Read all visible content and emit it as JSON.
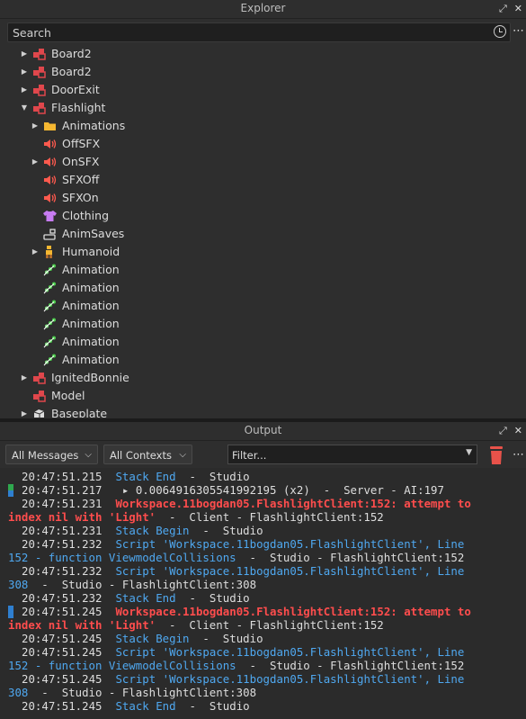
{
  "explorer": {
    "title": "Explorer",
    "search_placeholder": "Search",
    "items": [
      {
        "label": "Board2",
        "icon": "model-icon",
        "expand": "collapsed",
        "indent": 0
      },
      {
        "label": "Board2",
        "icon": "model-icon",
        "expand": "collapsed",
        "indent": 0
      },
      {
        "label": "DoorExit",
        "icon": "model-icon",
        "expand": "collapsed",
        "indent": 0
      },
      {
        "label": "Flashlight",
        "icon": "model-icon",
        "expand": "expanded",
        "indent": 0
      },
      {
        "label": "Animations",
        "icon": "folder-icon",
        "expand": "collapsed",
        "indent": 1
      },
      {
        "label": "OffSFX",
        "icon": "sound-icon",
        "expand": "none",
        "indent": 1
      },
      {
        "label": "OnSFX",
        "icon": "sound-icon",
        "expand": "collapsed",
        "indent": 1
      },
      {
        "label": "SFXOff",
        "icon": "sound-icon",
        "expand": "none",
        "indent": 1
      },
      {
        "label": "SFXOn",
        "icon": "sound-icon",
        "expand": "none",
        "indent": 1
      },
      {
        "label": "Clothing",
        "icon": "shirt-icon",
        "expand": "none",
        "indent": 1
      },
      {
        "label": "AnimSaves",
        "icon": "object-value-icon",
        "expand": "none",
        "indent": 1
      },
      {
        "label": "Humanoid",
        "icon": "humanoid-icon",
        "expand": "collapsed",
        "indent": 1
      },
      {
        "label": "Animation",
        "icon": "animation-icon",
        "expand": "none",
        "indent": 1
      },
      {
        "label": "Animation",
        "icon": "animation-icon",
        "expand": "none",
        "indent": 1
      },
      {
        "label": "Animation",
        "icon": "animation-icon",
        "expand": "none",
        "indent": 1
      },
      {
        "label": "Animation",
        "icon": "animation-icon",
        "expand": "none",
        "indent": 1
      },
      {
        "label": "Animation",
        "icon": "animation-icon",
        "expand": "none",
        "indent": 1
      },
      {
        "label": "Animation",
        "icon": "animation-icon",
        "expand": "none",
        "indent": 1
      },
      {
        "label": "IgnitedBonnie",
        "icon": "model-icon",
        "expand": "collapsed",
        "indent": 0
      },
      {
        "label": "Model",
        "icon": "model-icon",
        "expand": "none",
        "indent": 0
      },
      {
        "label": "Baseplate",
        "icon": "part-icon",
        "expand": "collapsed",
        "indent": 0
      }
    ]
  },
  "output": {
    "title": "Output",
    "messages_filter": "All Messages",
    "contexts_filter": "All Contexts",
    "filter_placeholder": "Filter...",
    "lines": [
      {
        "segments": [
          {
            "t": "20:47:51.215  ",
            "c": "out"
          },
          {
            "t": "Stack End",
            "c": "info"
          },
          {
            "t": "  -  Studio",
            "c": "out"
          }
        ]
      },
      {
        "segments": [
          {
            "t": "20:47:51.217   ",
            "c": "out"
          },
          {
            "t": "▸ 0.00649163055419921​95 (x2)",
            "c": "out"
          },
          {
            "t": "  -  Server - AI:197",
            "c": "out"
          }
        ],
        "marker": "server"
      },
      {
        "segments": [
          {
            "t": "20:47:51.231  ",
            "c": "out"
          },
          {
            "t": "Workspace.11bogdan05.FlashlightClient:152: attempt to",
            "c": "err"
          }
        ]
      },
      {
        "segments": [
          {
            "t": "index nil with 'Light'",
            "c": "err"
          },
          {
            "t": "  -  Client - FlashlightClient:152",
            "c": "out"
          }
        ],
        "wrap": true
      },
      {
        "segments": [
          {
            "t": "20:47:51.231  ",
            "c": "out"
          },
          {
            "t": "Stack Begin",
            "c": "info"
          },
          {
            "t": "  -  Studio",
            "c": "out"
          }
        ]
      },
      {
        "segments": [
          {
            "t": "20:47:51.232  ",
            "c": "out"
          },
          {
            "t": "Script 'Workspace.11bogdan05.FlashlightClient', Line",
            "c": "info"
          }
        ]
      },
      {
        "segments": [
          {
            "t": "152 - function ViewmodelCollisions",
            "c": "info"
          },
          {
            "t": "  -  Studio - FlashlightClient:152",
            "c": "out"
          }
        ],
        "wrap": true
      },
      {
        "segments": [
          {
            "t": "20:47:51.232  ",
            "c": "out"
          },
          {
            "t": "Script 'Workspace.11bogdan05.FlashlightClient', Line",
            "c": "info"
          }
        ]
      },
      {
        "segments": [
          {
            "t": "308",
            "c": "info"
          },
          {
            "t": "  -  Studio - FlashlightClient:308",
            "c": "out"
          }
        ],
        "wrap": true
      },
      {
        "segments": [
          {
            "t": "20:47:51.232  ",
            "c": "out"
          },
          {
            "t": "Stack End",
            "c": "info"
          },
          {
            "t": "  -  Studio",
            "c": "out"
          }
        ]
      },
      {
        "segments": [
          {
            "t": "20:47:51.245  ",
            "c": "out"
          },
          {
            "t": "Workspace.11bogdan05.FlashlightClient:152: attempt to",
            "c": "err"
          }
        ],
        "marker": "client"
      },
      {
        "segments": [
          {
            "t": "index nil with 'Light'",
            "c": "err"
          },
          {
            "t": "  -  Client - FlashlightClient:152",
            "c": "out"
          }
        ],
        "wrap": true
      },
      {
        "segments": [
          {
            "t": "20:47:51.245  ",
            "c": "out"
          },
          {
            "t": "Stack Begin",
            "c": "info"
          },
          {
            "t": "  -  Studio",
            "c": "out"
          }
        ]
      },
      {
        "segments": [
          {
            "t": "20:47:51.245  ",
            "c": "out"
          },
          {
            "t": "Script 'Workspace.11bogdan05.FlashlightClient', Line",
            "c": "info"
          }
        ]
      },
      {
        "segments": [
          {
            "t": "152 - function ViewmodelCollisions",
            "c": "info"
          },
          {
            "t": "  -  Studio - FlashlightClient:152",
            "c": "out"
          }
        ],
        "wrap": true
      },
      {
        "segments": [
          {
            "t": "20:47:51.245  ",
            "c": "out"
          },
          {
            "t": "Script 'Workspace.11bogdan05.FlashlightClient', Line",
            "c": "info"
          }
        ]
      },
      {
        "segments": [
          {
            "t": "308",
            "c": "info"
          },
          {
            "t": "  -  Studio - FlashlightClient:308",
            "c": "out"
          }
        ],
        "wrap": true
      },
      {
        "segments": [
          {
            "t": "20:47:51.245  ",
            "c": "out"
          },
          {
            "t": "Stack End",
            "c": "info"
          },
          {
            "t": "  -  Studio",
            "c": "out"
          }
        ]
      }
    ]
  },
  "colors": {
    "info_text": "#4fa8f0",
    "error_text": "#ff4d4d",
    "model_icon": "#e0474c",
    "folder_icon": "#f5b731",
    "sound_icon": "#ff5a4e",
    "shirt_icon": "#c77bf2",
    "animation_icon": "#4dd04d",
    "trash_icon": "#e8524a"
  }
}
